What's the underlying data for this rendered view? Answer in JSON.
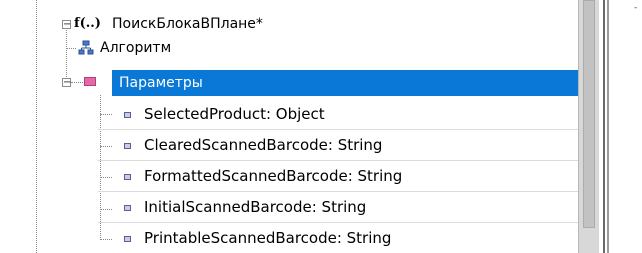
{
  "tree": {
    "root": {
      "icon_text": "f(..)",
      "label": "ПоискБлокаВПлане*",
      "expander": "−"
    },
    "algorithm": {
      "label": "Алгоритм"
    },
    "parameters": {
      "label": "Параметры",
      "expander": "−"
    },
    "params": [
      {
        "label": "SelectedProduct: Object"
      },
      {
        "label": "ClearedScannedBarcode: String"
      },
      {
        "label": "FormattedScannedBarcode: String"
      },
      {
        "label": "InitialScannedBarcode: String"
      },
      {
        "label": "PrintableScannedBarcode: String"
      }
    ]
  },
  "right_edge_mark": "-",
  "colors": {
    "selection": "#0a78d7",
    "selection_text": "#ffffff",
    "param_icon": "#c8cce8",
    "parameters_icon": "#e36aa5"
  }
}
